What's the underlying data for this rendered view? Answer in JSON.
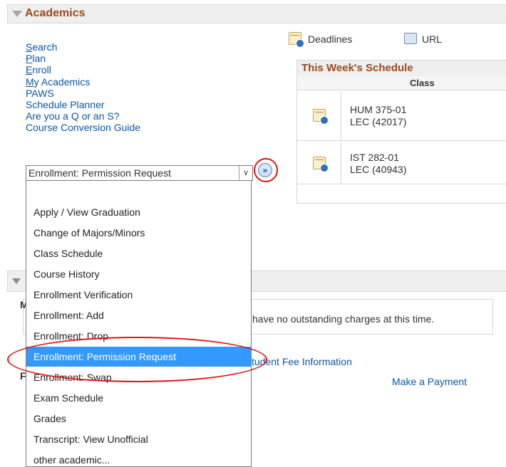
{
  "academics": {
    "title": "Academics"
  },
  "nav_links": [
    {
      "first": "S",
      "rest": "earch"
    },
    {
      "first": "P",
      "rest": "lan"
    },
    {
      "first": "E",
      "rest": "nroll"
    },
    {
      "first": "M",
      "rest": "y Academics"
    },
    {
      "first": "",
      "rest": "PAWS"
    },
    {
      "first": "",
      "rest": "Schedule Planner"
    },
    {
      "first": "",
      "rest": "Are you a Q or an S?"
    },
    {
      "first": "",
      "rest": "Course Conversion Guide"
    }
  ],
  "select": {
    "value": "Enrollment: Permission Request",
    "go_symbol": "»",
    "options": [
      "",
      "Apply / View Graduation",
      "Change of Majors/Minors",
      "Class Schedule",
      "Course History",
      "Enrollment Verification",
      "Enrollment: Add",
      "Enrollment: Drop",
      "Enrollment: Permission Request",
      "Enrollment: Swap",
      "Exam Schedule",
      "Grades",
      "Transcript: View Unofficial",
      "other academic..."
    ],
    "selected_index": 8
  },
  "right_links": {
    "deadlines": "Deadlines",
    "url": "URL"
  },
  "schedule": {
    "title": "This Week's Schedule",
    "class_header": "Class",
    "rows": [
      {
        "line1": "HUM 375-01",
        "line2": "LEC (42017)"
      },
      {
        "line1": "IST 282-01",
        "line2": "LEC (40943)"
      }
    ]
  },
  "lower": {
    "m_fragment": "M",
    "message": "have no outstanding charges at this time.",
    "fee_link": "tudent Fee Information",
    "f_fragment": "F",
    "payment_link": "Make a Payment"
  },
  "colors": {
    "header_text": "#9c4a1b",
    "link": "#0b56a6",
    "selection": "#3399ff",
    "annotation_red": "#e01515"
  }
}
